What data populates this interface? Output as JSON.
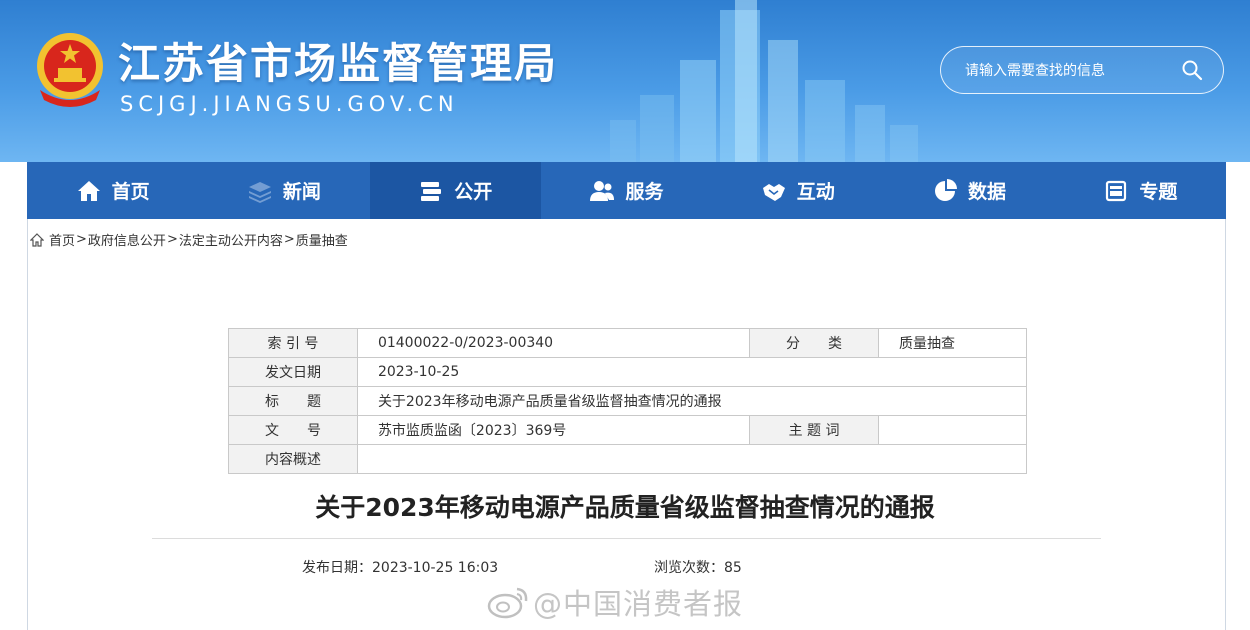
{
  "header": {
    "title": "江苏省市场监督管理局",
    "domain": "SCJGJ.JIANGSU.GOV.CN",
    "search_placeholder": "请输入需要查找的信息"
  },
  "nav": {
    "items": [
      {
        "label": "首页",
        "icon": "home-icon"
      },
      {
        "label": "新闻",
        "icon": "layers-icon"
      },
      {
        "label": "公开",
        "icon": "book-stack-icon",
        "active": true
      },
      {
        "label": "服务",
        "icon": "people-icon"
      },
      {
        "label": "互动",
        "icon": "handshake-icon"
      },
      {
        "label": "数据",
        "icon": "pie-chart-icon"
      },
      {
        "label": "专题",
        "icon": "folder-icon"
      }
    ]
  },
  "breadcrumb": {
    "items": [
      "首页",
      "政府信息公开",
      "法定主动公开内容",
      "质量抽查"
    ],
    "separator": ">"
  },
  "meta": {
    "index_label": "索 引 号",
    "index_value": "01400022-0/2023-00340",
    "category_label": "分　　类",
    "category_value": "质量抽查",
    "date_label": "发文日期",
    "date_value": "2023-10-25",
    "title_label": "标　　题",
    "title_value": "关于2023年移动电源产品质量省级监督抽查情况的通报",
    "docno_label": "文　　号",
    "docno_value": "苏市监质监函〔2023〕369号",
    "keywords_label": "主 题 词",
    "keywords_value": "",
    "summary_label": "内容概述",
    "summary_value": ""
  },
  "article": {
    "title": "关于2023年移动电源产品质量省级监督抽查情况的通报",
    "publish_label": "发布日期：",
    "publish_value": "2023-10-25 16:03",
    "views_label": "浏览次数：",
    "views_value": "85"
  },
  "watermark": {
    "text": "@中国消费者报"
  },
  "colors": {
    "header_blue": "#3a8ddc",
    "nav_blue": "#2767b8",
    "nav_active": "#1c56a3"
  }
}
